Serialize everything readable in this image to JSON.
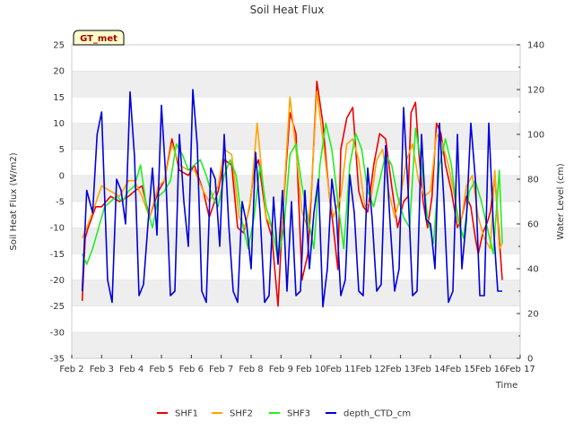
{
  "chart_data": {
    "type": "line",
    "title": "Soil Heat Flux",
    "xlabel": "Time",
    "ylabel": "Soil Heat Flux (W/m2)",
    "y2label": "Water Level (cm)",
    "badge": "GT_met",
    "x_ticks": [
      "Feb 2",
      "Feb 3",
      "Feb 4",
      "Feb 5",
      "Feb 6",
      "Feb 7",
      "Feb 8",
      "Feb 9",
      "Feb 10",
      "Feb 11",
      "Feb 12",
      "Feb 13",
      "Feb 14",
      "Feb 15",
      "Feb 16",
      "Feb 17"
    ],
    "xlim": [
      2,
      17
    ],
    "ylim": [
      -35,
      25
    ],
    "y_ticks": [
      25,
      20,
      15,
      10,
      5,
      0,
      -5,
      -10,
      -15,
      -20,
      -25,
      -30,
      -35
    ],
    "y2lim": [
      0,
      140
    ],
    "y2_ticks": [
      140,
      120,
      100,
      80,
      60,
      40,
      20,
      0
    ],
    "grid": "horizontal bands",
    "legend": "bottom",
    "series": [
      {
        "name": "SHF1",
        "axis": "left",
        "color": "#ee0000",
        "x": [
          2.35,
          2.45,
          2.55,
          2.8,
          3.0,
          3.3,
          3.6,
          3.9,
          4.1,
          4.35,
          4.6,
          4.9,
          5.1,
          5.35,
          5.6,
          5.9,
          6.1,
          6.4,
          6.6,
          6.9,
          7.1,
          7.35,
          7.55,
          7.75,
          7.95,
          8.1,
          8.25,
          8.5,
          8.7,
          8.9,
          9.05,
          9.3,
          9.5,
          9.7,
          9.9,
          10.0,
          10.2,
          10.4,
          10.6,
          10.75,
          10.9,
          11.0,
          11.2,
          11.4,
          11.6,
          11.75,
          11.9,
          12.1,
          12.3,
          12.5,
          12.7,
          12.9,
          13.1,
          13.25,
          13.35,
          13.5,
          13.6,
          13.75,
          13.9,
          14.05,
          14.2,
          14.35,
          14.5,
          14.7,
          14.9,
          15.05,
          15.2,
          15.35,
          15.5,
          15.6,
          15.75,
          15.9,
          16.0,
          16.15,
          16.3,
          16.4
        ],
        "y": [
          -24,
          -12,
          -10,
          -6,
          -6,
          -4,
          -5,
          -4,
          -3,
          -2,
          -8,
          -3,
          -1,
          7,
          1,
          0,
          2,
          -3,
          -8,
          -3,
          3,
          2,
          -10,
          -11,
          -6,
          1,
          3,
          -8,
          -12,
          -25,
          -8,
          12,
          8,
          -20,
          -15,
          -5,
          18,
          10,
          -3,
          -10,
          -18,
          5,
          11,
          13,
          -3,
          -6,
          -7,
          2,
          8,
          7,
          -2,
          -10,
          -5,
          -4,
          12,
          14,
          5,
          -5,
          -10,
          -4,
          10,
          8,
          2,
          -3,
          -10,
          -8,
          -4,
          -6,
          -12,
          -15,
          -11,
          -9,
          -7,
          0,
          -12,
          -20
        ]
      },
      {
        "name": "SHF2",
        "axis": "left",
        "color": "#ffa500",
        "x": [
          2.35,
          2.5,
          2.7,
          3.0,
          3.3,
          3.6,
          3.9,
          4.1,
          4.35,
          4.6,
          4.9,
          5.1,
          5.35,
          5.6,
          5.9,
          6.1,
          6.4,
          6.6,
          6.9,
          7.1,
          7.35,
          7.6,
          7.8,
          8.0,
          8.2,
          8.5,
          8.7,
          8.9,
          9.05,
          9.3,
          9.5,
          9.7,
          9.9,
          10.0,
          10.2,
          10.4,
          10.6,
          10.75,
          11.0,
          11.2,
          11.4,
          11.6,
          11.8,
          12.0,
          12.2,
          12.4,
          12.6,
          12.8,
          13.0,
          13.2,
          13.4,
          13.6,
          13.8,
          14.0,
          14.2,
          14.4,
          14.6,
          14.8,
          15.0,
          15.2,
          15.4,
          15.6,
          15.8,
          16.0,
          16.15,
          16.3,
          16.4
        ],
        "y": [
          -12,
          -10,
          -7,
          -2,
          -3,
          -4,
          -1,
          -1,
          -4,
          -8,
          -2,
          -1,
          6,
          2,
          1,
          1,
          -3,
          -5,
          -2,
          5,
          4,
          -8,
          -10,
          -4,
          10,
          -8,
          -10,
          -16,
          -8,
          15,
          5,
          -7,
          -10,
          -4,
          16,
          7,
          -3,
          -8,
          -4,
          6,
          7,
          3,
          -6,
          -5,
          3,
          5,
          -3,
          -8,
          -4,
          3,
          6,
          -1,
          -4,
          -3,
          8,
          6,
          2,
          -4,
          -10,
          -2,
          0,
          -8,
          -12,
          -14,
          1,
          -14,
          -13
        ]
      },
      {
        "name": "SHF3",
        "axis": "left",
        "color": "#22ee22",
        "x": [
          2.35,
          2.5,
          2.7,
          2.9,
          3.1,
          3.3,
          3.5,
          3.7,
          3.9,
          4.1,
          4.3,
          4.5,
          4.7,
          4.9,
          5.1,
          5.3,
          5.5,
          5.7,
          5.9,
          6.1,
          6.3,
          6.5,
          6.7,
          6.9,
          7.1,
          7.3,
          7.5,
          7.7,
          7.9,
          8.1,
          8.3,
          8.5,
          8.7,
          8.9,
          9.1,
          9.3,
          9.5,
          9.7,
          9.9,
          10.1,
          10.3,
          10.5,
          10.7,
          10.9,
          11.1,
          11.3,
          11.5,
          11.7,
          11.9,
          12.1,
          12.3,
          12.5,
          12.7,
          12.9,
          13.1,
          13.3,
          13.5,
          13.7,
          13.9,
          14.1,
          14.3,
          14.5,
          14.7,
          14.9,
          15.1,
          15.3,
          15.5,
          15.7,
          15.9,
          16.1,
          16.3,
          16.4
        ],
        "y": [
          -15,
          -17,
          -14,
          -10,
          -6,
          -5,
          -4,
          -5,
          -3,
          -2,
          2,
          -6,
          -10,
          -4,
          -3,
          -1,
          6,
          4,
          1,
          2,
          3,
          0,
          -4,
          -6,
          0,
          3,
          0,
          -9,
          -14,
          -8,
          2,
          -6,
          -10,
          -16,
          -10,
          4,
          6,
          -2,
          -8,
          -14,
          2,
          10,
          5,
          -5,
          -14,
          2,
          8,
          5,
          -3,
          -6,
          -1,
          4,
          2,
          -4,
          -8,
          -10,
          9,
          2,
          -8,
          -13,
          2,
          7,
          2,
          -8,
          -12,
          -3,
          -1,
          -5,
          -10,
          -15,
          1,
          -13
        ]
      },
      {
        "name": "depth_CTD_cm",
        "axis": "right",
        "color": "#0000dd",
        "x": [
          2.35,
          2.5,
          2.7,
          2.85,
          3.0,
          3.2,
          3.35,
          3.5,
          3.65,
          3.8,
          3.95,
          4.1,
          4.25,
          4.4,
          4.55,
          4.7,
          4.85,
          5.0,
          5.15,
          5.3,
          5.45,
          5.6,
          5.75,
          5.9,
          6.05,
          6.2,
          6.35,
          6.5,
          6.65,
          6.8,
          6.95,
          7.1,
          7.25,
          7.4,
          7.55,
          7.7,
          7.85,
          8.0,
          8.15,
          8.3,
          8.45,
          8.6,
          8.75,
          8.9,
          9.05,
          9.2,
          9.35,
          9.5,
          9.65,
          9.8,
          9.95,
          10.1,
          10.25,
          10.4,
          10.55,
          10.7,
          10.85,
          11.0,
          11.15,
          11.3,
          11.45,
          11.6,
          11.75,
          11.9,
          12.05,
          12.2,
          12.35,
          12.5,
          12.65,
          12.8,
          12.95,
          13.1,
          13.25,
          13.4,
          13.55,
          13.7,
          13.85,
          14.0,
          14.15,
          14.3,
          14.45,
          14.6,
          14.75,
          14.9,
          15.05,
          15.2,
          15.35,
          15.5,
          15.65,
          15.8,
          15.95,
          16.1,
          16.25,
          16.4
        ],
        "y": [
          30,
          75,
          65,
          100,
          110,
          35,
          25,
          80,
          75,
          60,
          119,
          90,
          28,
          33,
          60,
          85,
          55,
          113,
          80,
          28,
          30,
          100,
          70,
          50,
          120,
          95,
          30,
          25,
          85,
          80,
          50,
          100,
          60,
          30,
          25,
          70,
          60,
          40,
          92,
          65,
          25,
          28,
          72,
          42,
          75,
          30,
          70,
          28,
          30,
          75,
          40,
          65,
          80,
          23,
          40,
          80,
          65,
          28,
          35,
          82,
          65,
          30,
          28,
          85,
          62,
          30,
          33,
          95,
          60,
          30,
          40,
          112,
          75,
          28,
          30,
          100,
          62,
          60,
          40,
          105,
          70,
          25,
          30,
          100,
          40,
          62,
          105,
          80,
          28,
          28,
          105,
          60,
          30,
          30
        ]
      }
    ]
  }
}
